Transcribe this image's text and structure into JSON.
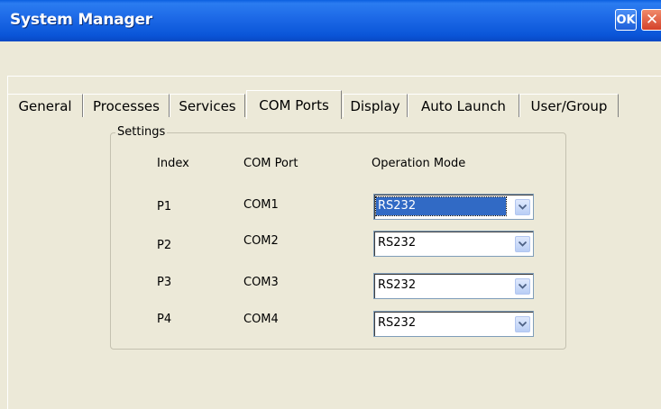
{
  "window": {
    "title": "System Manager",
    "ok_label": "OK",
    "close_label": "✕"
  },
  "tabs": [
    {
      "label": "General"
    },
    {
      "label": "Processes"
    },
    {
      "label": "Services"
    },
    {
      "label": "COM Ports"
    },
    {
      "label": "Display"
    },
    {
      "label": "Auto Launch"
    },
    {
      "label": "User/Group"
    }
  ],
  "active_tab": "COM Ports",
  "settings": {
    "group_title": "Settings",
    "headers": {
      "index": "Index",
      "com_port": "COM Port",
      "operation_mode": "Operation Mode"
    },
    "rows": [
      {
        "index": "P1",
        "com_port": "COM1",
        "mode": "RS232"
      },
      {
        "index": "P2",
        "com_port": "COM2",
        "mode": "RS232"
      },
      {
        "index": "P3",
        "com_port": "COM3",
        "mode": "RS232"
      },
      {
        "index": "P4",
        "com_port": "COM4",
        "mode": "RS232"
      }
    ]
  },
  "colors": {
    "titlebar": "#1c68e6",
    "selection": "#316ac5",
    "window_bg": "#ece9d8"
  }
}
